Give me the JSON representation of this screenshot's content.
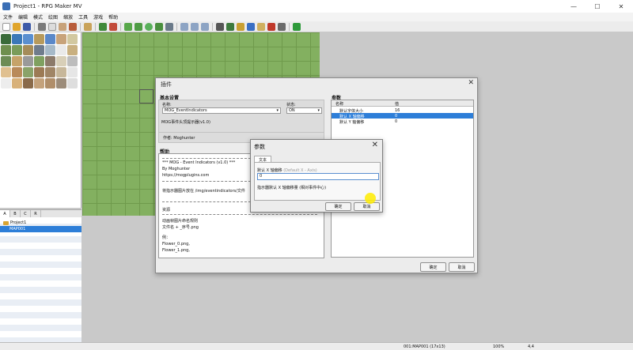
{
  "window": {
    "title": "Project1 - RPG Maker MV",
    "min": "—",
    "max": "☐",
    "close": "✕"
  },
  "menu": [
    "文件",
    "编辑",
    "模式",
    "绘图",
    "缩放",
    "工具",
    "游戏",
    "帮助"
  ],
  "tileset_tabs": [
    "A",
    "B",
    "C",
    "R"
  ],
  "maptree": {
    "project": "Project1",
    "map": "MAP001"
  },
  "status": {
    "map": "001:MAP001 (17x13)",
    "zoom": "100%",
    "coord": "4,4"
  },
  "plugin_dialog": {
    "title": "插件",
    "basic_title": "基本设置",
    "name_label": "名称:",
    "name_value": "MOG_EventIndicators",
    "state_label": "状态:",
    "state_value": "ON",
    "description": "MOG事件头顶提示器(v1.0)",
    "author": "作者: Moghunter",
    "help_title": "帮助",
    "help_lines": [
      "*** MOG - Event Indicators (v1.0) ***",
      "By Moghunter",
      "https://mogplugins.com",
      "将指示器图片放在 /img/eventindicators/文件",
      "资源",
      "动画帧图片命名规则",
      "文件名 + _序号.png",
      "例：",
      "Flower_0.png,",
      "Flower_1.png,"
    ],
    "params_title": "参数",
    "params_col_name": "名称",
    "params_col_value": "值",
    "params": [
      {
        "name": "默认字体大小",
        "value": "16"
      },
      {
        "name": "默认 X 轴偏移",
        "value": "0"
      },
      {
        "name": "默认 Y 轴偏移",
        "value": "0"
      }
    ],
    "ok": "确定",
    "cancel": "取消"
  },
  "param_dialog": {
    "title": "参数",
    "tab": "文本",
    "field_label": "默认 X 轴偏移",
    "field_hint": "(Default X - Axis)",
    "value": "0",
    "desc": "指示器默认 X 轴偏移量 (相对事件中心)",
    "ok": "确定",
    "cancel": "取消"
  },
  "colors": {
    "accent": "#2d7ed8",
    "map_grass": "#83b060"
  }
}
